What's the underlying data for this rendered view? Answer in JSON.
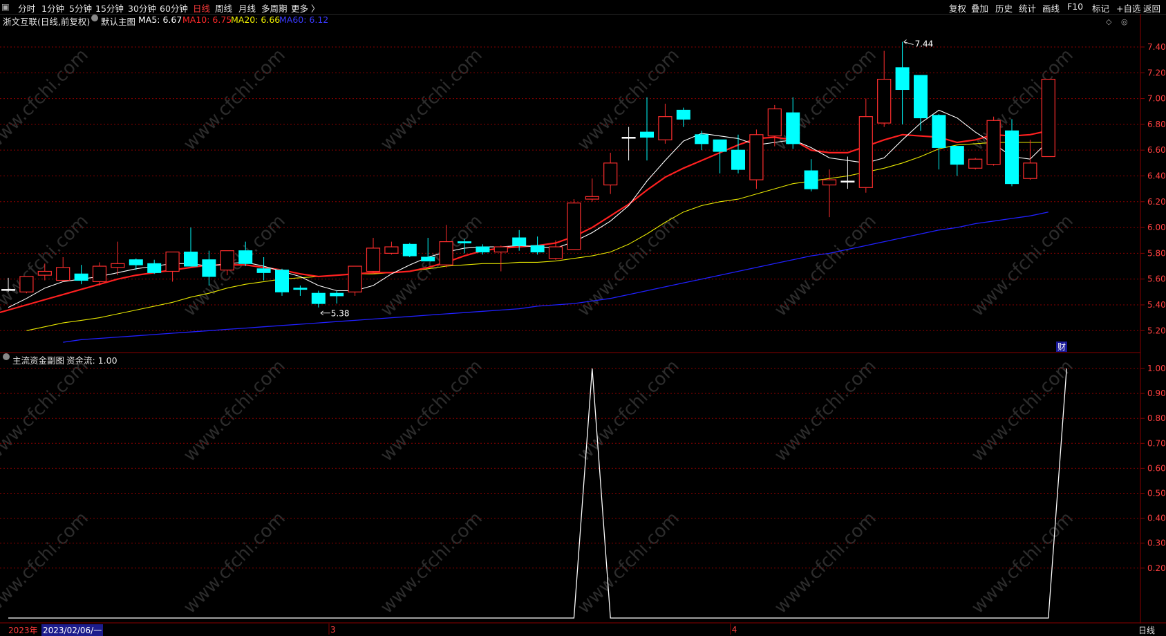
{
  "toolbar": {
    "left_items": [
      "分时",
      "1分钟",
      "5分钟",
      "15分钟",
      "30分钟",
      "60分钟",
      "日线",
      "周线",
      "月线",
      "多周期",
      "更多 〉"
    ],
    "active": "日线",
    "right_items": [
      "复权",
      "叠加",
      "历史",
      "统计",
      "画线",
      "F10",
      "标记",
      "+自选",
      "返回"
    ],
    "icon": "window-menu-icon"
  },
  "legend": {
    "stock": "浙文互联(日线,前复权)",
    "main_chart": "默认主图",
    "ma5": "MA5: 6.67",
    "ma10": "MA10: 6.75",
    "ma20": "MA20: 6.66",
    "ma60": "MA60: 6.12"
  },
  "sub_legend": {
    "name": "主流资金副图",
    "value": "资金流: 1.00"
  },
  "bottom": {
    "year": "2023年",
    "date": "2023/02/06/一",
    "period": "日线",
    "month_marks": [
      "3",
      "4"
    ]
  },
  "colors": {
    "up": "#ff2e2e",
    "down": "#00ffff",
    "ma5": "#ffffff",
    "ma10": "#ff2020",
    "ma20": "#e8e800",
    "ma60": "#2020ff",
    "grid": "#8a0000",
    "axis_text": "#ff4040"
  },
  "annotations": {
    "high": "7.44",
    "low": "5.38",
    "fin_tag": "财"
  },
  "watermark": "www.cfchi.com",
  "chart_data": [
    {
      "type": "candlestick",
      "title": "浙文互联(日线,前复权)",
      "y_ticks": [
        "7.40",
        "7.20",
        "7.00",
        "6.80",
        "6.60",
        "6.40",
        "6.20",
        "6.00",
        "5.80",
        "5.60",
        "5.40",
        "5.20"
      ],
      "ylim": [
        5.03,
        7.55
      ],
      "candles": [
        {
          "o": 5.52,
          "c": 5.52,
          "h": 5.61,
          "l": 5.5
        },
        {
          "o": 5.5,
          "c": 5.62,
          "h": 5.62,
          "l": 5.49
        },
        {
          "o": 5.63,
          "c": 5.66,
          "h": 5.72,
          "l": 5.59
        },
        {
          "o": 5.59,
          "c": 5.69,
          "h": 5.77,
          "l": 5.58
        },
        {
          "o": 5.64,
          "c": 5.59,
          "h": 5.71,
          "l": 5.56
        },
        {
          "o": 5.58,
          "c": 5.7,
          "h": 5.73,
          "l": 5.55
        },
        {
          "o": 5.69,
          "c": 5.72,
          "h": 5.89,
          "l": 5.63
        },
        {
          "o": 5.75,
          "c": 5.71,
          "h": 5.76,
          "l": 5.67
        },
        {
          "o": 5.72,
          "c": 5.65,
          "h": 5.75,
          "l": 5.64
        },
        {
          "o": 5.66,
          "c": 5.81,
          "h": 5.81,
          "l": 5.58
        },
        {
          "o": 5.81,
          "c": 5.7,
          "h": 6.0,
          "l": 5.71
        },
        {
          "o": 5.75,
          "c": 5.62,
          "h": 5.82,
          "l": 5.55
        },
        {
          "o": 5.67,
          "c": 5.82,
          "h": 5.81,
          "l": 5.63
        },
        {
          "o": 5.82,
          "c": 5.72,
          "h": 5.89,
          "l": 5.7
        },
        {
          "o": 5.68,
          "c": 5.65,
          "h": 5.77,
          "l": 5.59
        },
        {
          "o": 5.67,
          "c": 5.5,
          "h": 5.68,
          "l": 5.47
        },
        {
          "o": 5.53,
          "c": 5.52,
          "h": 5.55,
          "l": 5.47
        },
        {
          "o": 5.49,
          "c": 5.41,
          "h": 5.51,
          "l": 5.38
        },
        {
          "o": 5.49,
          "c": 5.47,
          "h": 5.51,
          "l": 5.41
        },
        {
          "o": 5.5,
          "c": 5.7,
          "h": 5.7,
          "l": 5.47
        },
        {
          "o": 5.66,
          "c": 5.84,
          "h": 5.92,
          "l": 5.64
        },
        {
          "o": 5.8,
          "c": 5.85,
          "h": 5.89,
          "l": 5.79
        },
        {
          "o": 5.87,
          "c": 5.78,
          "h": 5.88,
          "l": 5.77
        },
        {
          "o": 5.77,
          "c": 5.74,
          "h": 5.92,
          "l": 5.74
        },
        {
          "o": 5.71,
          "c": 5.89,
          "h": 6.02,
          "l": 5.69
        },
        {
          "o": 5.89,
          "c": 5.88,
          "h": 5.91,
          "l": 5.8
        },
        {
          "o": 5.85,
          "c": 5.81,
          "h": 5.87,
          "l": 5.79
        },
        {
          "o": 5.81,
          "c": 5.85,
          "h": 5.86,
          "l": 5.66
        },
        {
          "o": 5.92,
          "c": 5.86,
          "h": 5.98,
          "l": 5.82
        },
        {
          "o": 5.86,
          "c": 5.81,
          "h": 5.93,
          "l": 5.79
        },
        {
          "o": 5.76,
          "c": 5.85,
          "h": 5.9,
          "l": 5.75
        },
        {
          "o": 5.83,
          "c": 6.19,
          "h": 6.22,
          "l": 5.83
        },
        {
          "o": 6.22,
          "c": 6.24,
          "h": 6.38,
          "l": 6.2
        },
        {
          "o": 6.33,
          "c": 6.5,
          "h": 6.58,
          "l": 6.26
        },
        {
          "o": 6.7,
          "c": 6.7,
          "h": 6.78,
          "l": 6.52
        },
        {
          "o": 6.74,
          "c": 6.7,
          "h": 7.01,
          "l": 6.52
        },
        {
          "o": 6.68,
          "c": 6.86,
          "h": 6.96,
          "l": 6.65
        },
        {
          "o": 6.91,
          "c": 6.84,
          "h": 6.93,
          "l": 6.78
        },
        {
          "o": 6.72,
          "c": 6.65,
          "h": 6.75,
          "l": 6.6
        },
        {
          "o": 6.68,
          "c": 6.59,
          "h": 6.68,
          "l": 6.42
        },
        {
          "o": 6.6,
          "c": 6.45,
          "h": 6.72,
          "l": 6.42
        },
        {
          "o": 6.37,
          "c": 6.72,
          "h": 6.76,
          "l": 6.3
        },
        {
          "o": 6.71,
          "c": 6.92,
          "h": 6.95,
          "l": 6.63
        },
        {
          "o": 6.89,
          "c": 6.65,
          "h": 7.01,
          "l": 6.61
        },
        {
          "o": 6.44,
          "c": 6.3,
          "h": 6.53,
          "l": 6.28
        },
        {
          "o": 6.33,
          "c": 6.37,
          "h": 6.45,
          "l": 6.08
        },
        {
          "o": 6.36,
          "c": 6.36,
          "h": 6.55,
          "l": 6.3
        },
        {
          "o": 6.31,
          "c": 6.86,
          "h": 7.0,
          "l": 6.27
        },
        {
          "o": 6.81,
          "c": 7.15,
          "h": 7.37,
          "l": 6.78
        },
        {
          "o": 7.24,
          "c": 7.07,
          "h": 7.44,
          "l": 6.8
        },
        {
          "o": 7.18,
          "c": 6.85,
          "h": 7.18,
          "l": 6.75
        },
        {
          "o": 6.87,
          "c": 6.62,
          "h": 6.88,
          "l": 6.45
        },
        {
          "o": 6.63,
          "c": 6.49,
          "h": 6.63,
          "l": 6.4
        },
        {
          "o": 6.46,
          "c": 6.53,
          "h": 6.54,
          "l": 6.45
        },
        {
          "o": 6.49,
          "c": 6.83,
          "h": 6.86,
          "l": 6.48
        },
        {
          "o": 6.75,
          "c": 6.34,
          "h": 6.84,
          "l": 6.32
        },
        {
          "o": 6.38,
          "c": 6.5,
          "h": 6.68,
          "l": 6.37
        },
        {
          "o": 6.55,
          "c": 7.15,
          "h": 7.15,
          "l": 6.55
        }
      ],
      "ma": {
        "ma5": [
          5.38,
          5.45,
          5.53,
          5.58,
          5.6,
          5.62,
          5.65,
          5.68,
          5.7,
          5.72,
          5.72,
          5.7,
          5.72,
          5.73,
          5.7,
          5.66,
          5.62,
          5.55,
          5.51,
          5.51,
          5.55,
          5.64,
          5.71,
          5.77,
          5.81,
          5.84,
          5.85,
          5.85,
          5.86,
          5.85,
          5.84,
          5.89,
          5.96,
          6.05,
          6.17,
          6.36,
          6.52,
          6.67,
          6.73,
          6.71,
          6.69,
          6.64,
          6.66,
          6.68,
          6.62,
          6.54,
          6.52,
          6.5,
          6.54,
          6.68,
          6.81,
          6.91,
          6.85,
          6.74,
          6.65,
          6.55,
          6.53,
          6.67
        ],
        "ma10": [
          5.28,
          5.32,
          5.36,
          5.4,
          5.44,
          5.48,
          5.52,
          5.56,
          5.6,
          5.63,
          5.65,
          5.67,
          5.69,
          5.71,
          5.71,
          5.71,
          5.69,
          5.67,
          5.64,
          5.62,
          5.63,
          5.64,
          5.65,
          5.65,
          5.66,
          5.69,
          5.73,
          5.78,
          5.82,
          5.84,
          5.85,
          5.86,
          5.88,
          5.93,
          6.0,
          6.09,
          6.18,
          6.29,
          6.39,
          6.46,
          6.52,
          6.58,
          6.64,
          6.69,
          6.7,
          6.68,
          6.6,
          6.58,
          6.58,
          6.63,
          6.68,
          6.72,
          6.71,
          6.7,
          6.66,
          6.68,
          6.72,
          6.71,
          6.72,
          6.75
        ],
        "ma20": [
          5.2,
          5.23,
          5.26,
          5.28,
          5.3,
          5.33,
          5.36,
          5.39,
          5.42,
          5.46,
          5.49,
          5.53,
          5.56,
          5.58,
          5.6,
          5.61,
          5.62,
          5.63,
          5.64,
          5.64,
          5.65,
          5.66,
          5.68,
          5.7,
          5.71,
          5.72,
          5.72,
          5.73,
          5.73,
          5.74,
          5.76,
          5.78,
          5.81,
          5.87,
          5.95,
          6.04,
          6.12,
          6.17,
          6.2,
          6.22,
          6.26,
          6.3,
          6.34,
          6.36,
          6.38,
          6.4,
          6.43,
          6.46,
          6.5,
          6.55,
          6.61,
          6.64,
          6.65,
          6.66,
          6.66,
          6.66,
          6.66
        ],
        "ma60": [
          5.11,
          5.13,
          5.14,
          5.15,
          5.16,
          5.17,
          5.18,
          5.19,
          5.2,
          5.21,
          5.22,
          5.23,
          5.24,
          5.25,
          5.26,
          5.27,
          5.28,
          5.29,
          5.3,
          5.31,
          5.32,
          5.33,
          5.34,
          5.35,
          5.36,
          5.37,
          5.39,
          5.4,
          5.41,
          5.43,
          5.45,
          5.48,
          5.51,
          5.54,
          5.57,
          5.6,
          5.63,
          5.66,
          5.69,
          5.72,
          5.75,
          5.78,
          5.8,
          5.83,
          5.86,
          5.89,
          5.92,
          5.95,
          5.98,
          6.0,
          6.03,
          6.05,
          6.07,
          6.09,
          6.12
        ]
      }
    },
    {
      "type": "line",
      "title": "主流资金副图",
      "series": [
        {
          "name": "资金流",
          "values": [
            0,
            0,
            0,
            0,
            0,
            0,
            0,
            0,
            0,
            0,
            0,
            0,
            0,
            0,
            0,
            0,
            0,
            0,
            0,
            0,
            0,
            0,
            0,
            0,
            0,
            0,
            0,
            0,
            0,
            0,
            0,
            0,
            1,
            0,
            0,
            0,
            0,
            0,
            0,
            0,
            0,
            0,
            0,
            0,
            0,
            0,
            0,
            0,
            0,
            0,
            0,
            0,
            0,
            0,
            0,
            0,
            0,
            0,
            1
          ]
        }
      ],
      "y_ticks": [
        "1.00",
        "0.90",
        "0.80",
        "0.70",
        "0.60",
        "0.50",
        "0.40",
        "0.30",
        "0.20"
      ],
      "ylim": [
        0,
        1.0
      ]
    }
  ]
}
